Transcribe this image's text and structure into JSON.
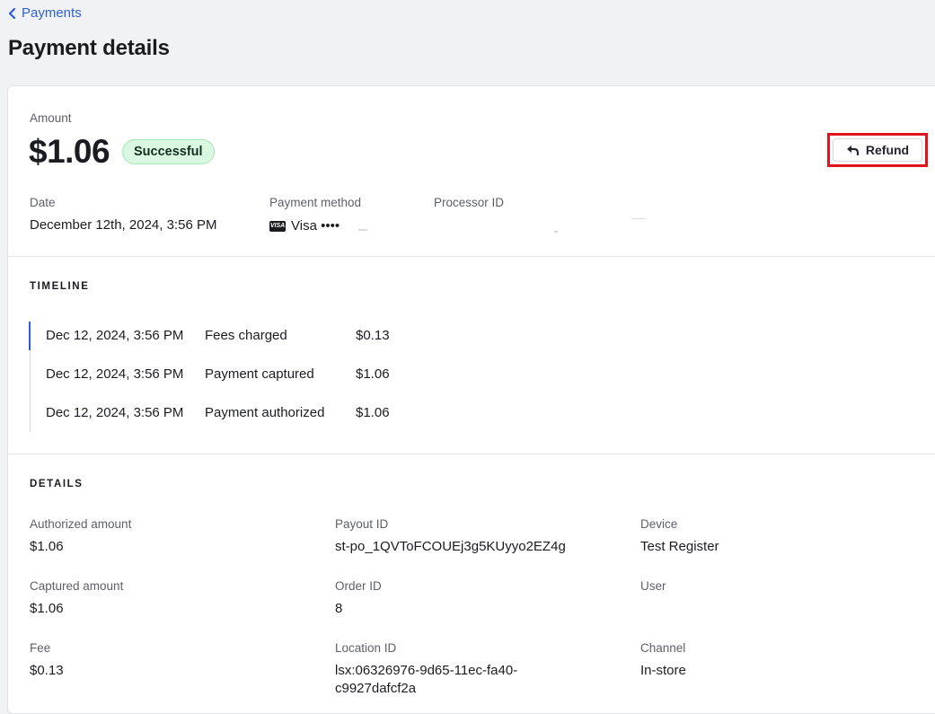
{
  "nav": {
    "back_label": "Payments"
  },
  "page": {
    "title": "Payment details"
  },
  "summary": {
    "amount_label": "Amount",
    "amount": "$1.06",
    "status": "Successful",
    "refund_label": "Refund",
    "date_label": "Date",
    "date": "December 12th, 2024, 3:56 PM",
    "payment_method_label": "Payment method",
    "payment_method": "Visa ••••",
    "processor_id_label": "Processor ID"
  },
  "timeline": {
    "title": "TIMELINE",
    "events": [
      {
        "date": "Dec 12, 2024, 3:56 PM",
        "event": "Fees charged",
        "amount": "$0.13"
      },
      {
        "date": "Dec 12, 2024, 3:56 PM",
        "event": "Payment captured",
        "amount": "$1.06"
      },
      {
        "date": "Dec 12, 2024, 3:56 PM",
        "event": "Payment authorized",
        "amount": "$1.06"
      }
    ]
  },
  "details": {
    "title": "DETAILS",
    "authorized_amount": {
      "label": "Authorized amount",
      "value": "$1.06"
    },
    "payout_id": {
      "label": "Payout ID",
      "value": "st-po_1QVToFCOUEj3g5KUyyo2EZ4g"
    },
    "device": {
      "label": "Device",
      "value": "Test Register"
    },
    "captured_amount": {
      "label": "Captured amount",
      "value": "$1.06"
    },
    "order_id": {
      "label": "Order ID",
      "value": "8"
    },
    "user": {
      "label": "User",
      "value": ""
    },
    "fee": {
      "label": "Fee",
      "value": "$0.13"
    },
    "location_id": {
      "label": "Location ID",
      "value": "lsx:06326976-9d65-11ec-fa40-c9927dafcf2a"
    },
    "channel": {
      "label": "Channel",
      "value": "In-store"
    }
  },
  "colors": {
    "accent": "#2c5fd3",
    "success_bg": "#d9f7e1",
    "highlight": "#e1141d"
  },
  "icons": {
    "back": "chevron-left-icon",
    "refund": "reply-arrow-icon",
    "card_brand": "visa-icon"
  }
}
